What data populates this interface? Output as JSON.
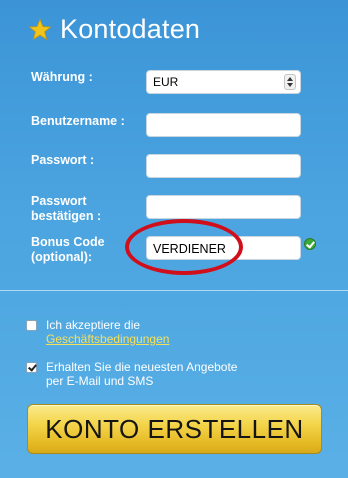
{
  "header": {
    "title": "Kontodaten",
    "icon": "star-icon",
    "icon_color": "#f0c419"
  },
  "form": {
    "currency_label": "Währung :",
    "currency_value": "EUR",
    "username_label": "Benutzername :",
    "username_value": "",
    "password_label": "Passwort :",
    "password_value": "",
    "confirm_label_line1": "Passwort",
    "confirm_label_line2": "bestätigen :",
    "confirm_value": "",
    "bonus_label_line1": "Bonus Code",
    "bonus_label_line2": "(optional):",
    "bonus_value": "VERDIENER",
    "bonus_valid_icon": "check-circle-icon"
  },
  "checkboxes": {
    "terms_text": "Ich akzeptiere die",
    "terms_link": "Geschäftsbedingungen",
    "terms_checked": false,
    "offers_line1": "Erhalten Sie die neuesten Angebote",
    "offers_line2": "per E-Mail und SMS",
    "offers_checked": true
  },
  "cta": {
    "label": "KONTO ERSTELLEN"
  },
  "colors": {
    "background": "#4aa3df",
    "highlight_circle": "#d10f1a",
    "link": "#f5e05a",
    "button_gold": "#f3d54a"
  }
}
